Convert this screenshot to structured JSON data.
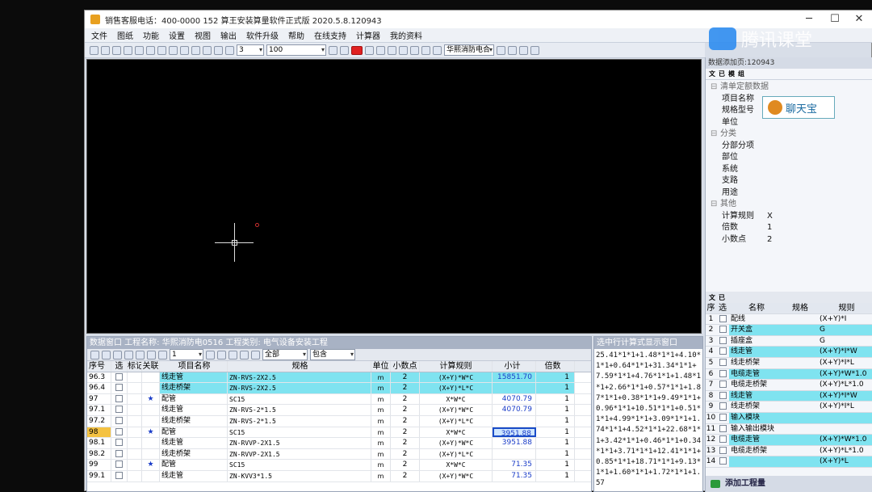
{
  "window": {
    "title": "销售客服电话：400-0000 152  算王安装算量软件正式版 2020.5.8.120943"
  },
  "menu": [
    "文件",
    "图纸",
    "功能",
    "设置",
    "视图",
    "输出",
    "软件升级",
    "帮助",
    "在线支持",
    "计算器",
    "我的资料"
  ],
  "toolbar": {
    "scale_value": "3",
    "zoom_value": "100",
    "project_combo": "华熙消防电合"
  },
  "watermark": "腾讯课堂",
  "right_panel": {
    "title": "数据添加页:120943",
    "tools": [
      "文",
      "已",
      "模",
      "组"
    ],
    "chat_button": "聊天宝",
    "tree": [
      {
        "type": "cat",
        "label": "清单定额数据"
      },
      {
        "type": "leaf",
        "label": "项目名称",
        "value": ""
      },
      {
        "type": "leaf",
        "label": "规格型号",
        "value": ""
      },
      {
        "type": "leaf",
        "label": "单位",
        "value": ""
      },
      {
        "type": "cat",
        "label": "分类"
      },
      {
        "type": "leaf",
        "label": "分部分项",
        "value": ""
      },
      {
        "type": "leaf",
        "label": "部位",
        "value": ""
      },
      {
        "type": "leaf",
        "label": "系统",
        "value": ""
      },
      {
        "type": "leaf",
        "label": "支路",
        "value": ""
      },
      {
        "type": "leaf",
        "label": "用途",
        "value": ""
      },
      {
        "type": "cat",
        "label": "其他"
      },
      {
        "type": "leaf",
        "label": "计算规则",
        "value": "X"
      },
      {
        "type": "leaf",
        "label": "倍数",
        "value": "1"
      },
      {
        "type": "leaf",
        "label": "小数点",
        "value": "2"
      }
    ],
    "grid_headers": {
      "no": "序",
      "sel": "选",
      "name": "名称",
      "spec": "规格",
      "rule": "规则"
    },
    "grid_rows": [
      {
        "no": "1",
        "name": "配线",
        "spec": "",
        "rule": "(X+Y)*I",
        "cyan": false
      },
      {
        "no": "2",
        "name": "开关盒",
        "spec": "",
        "rule": "G",
        "cyan": true
      },
      {
        "no": "3",
        "name": "插座盒",
        "spec": "",
        "rule": "G",
        "cyan": false
      },
      {
        "no": "4",
        "name": "线走管",
        "spec": "",
        "rule": "(X+Y)*I*W",
        "cyan": true
      },
      {
        "no": "5",
        "name": "线走桥架",
        "spec": "",
        "rule": "(X+Y)*I*L",
        "cyan": false
      },
      {
        "no": "6",
        "name": "电缆走管",
        "spec": "",
        "rule": "(X+Y)*W*1.0",
        "cyan": true
      },
      {
        "no": "7",
        "name": "电缆走桥架",
        "spec": "",
        "rule": "(X+Y)*L*1.0",
        "cyan": false
      },
      {
        "no": "8",
        "name": "线走管",
        "spec": "",
        "rule": "(X+Y)*I*W",
        "cyan": true
      },
      {
        "no": "9",
        "name": "线走桥架",
        "spec": "",
        "rule": "(X+Y)*I*L",
        "cyan": false
      },
      {
        "no": "10",
        "name": "输入模块",
        "spec": "",
        "rule": "",
        "cyan": true
      },
      {
        "no": "11",
        "name": "输入输出模块",
        "spec": "",
        "rule": "",
        "cyan": false
      },
      {
        "no": "12",
        "name": "电缆走管",
        "spec": "",
        "rule": "(X+Y)*W*1.0",
        "cyan": true
      },
      {
        "no": "13",
        "name": "电缆走桥架",
        "spec": "",
        "rule": "(X+Y)*L*1.0",
        "cyan": false
      },
      {
        "no": "14",
        "name": "",
        "spec": "",
        "rule": "(X+Y)*L",
        "cyan": true
      }
    ],
    "add_button": "添加工程量"
  },
  "data_panel": {
    "title": "数据窗口 工程名称: 华熙消防电0516 工程类别: 电气设备安装工程",
    "filter1": "1",
    "filter2": "全部",
    "filter3": "包含",
    "headers": {
      "no": "序号",
      "sel": "选",
      "mark": "标记",
      "rel": "关联",
      "name": "项目名称",
      "spec": "规格",
      "unit": "单位",
      "dp": "小数点",
      "rule": "计算规则",
      "subtotal": "小计",
      "mult": "倍数"
    },
    "rows": [
      {
        "no": "96.3",
        "rel": "",
        "name": "线走管",
        "spec": "ZN-RVS-2X2.5",
        "unit": "m",
        "dp": "2",
        "rule": "(X+Y)*W*C",
        "subtotal": "15851.70",
        "mult": "1",
        "cyan": true
      },
      {
        "no": "96.4",
        "rel": "",
        "name": "线走桥架",
        "spec": "ZN-RVS-2X2.5",
        "unit": "m",
        "dp": "2",
        "rule": "(X+Y)*L*C",
        "subtotal": "",
        "mult": "1",
        "cyan": true
      },
      {
        "no": "97",
        "rel": "★",
        "name": "配管",
        "spec": "SC15",
        "unit": "m",
        "dp": "2",
        "rule": "X*W*C",
        "subtotal": "4070.79",
        "mult": "1"
      },
      {
        "no": "97.1",
        "rel": "",
        "name": "线走管",
        "spec": "ZN-RVS-2*1.5",
        "unit": "m",
        "dp": "2",
        "rule": "(X+Y)*W*C",
        "subtotal": "4070.79",
        "mult": "1"
      },
      {
        "no": "97.2",
        "rel": "",
        "name": "线走桥架",
        "spec": "ZN-RVS-2*1.5",
        "unit": "m",
        "dp": "2",
        "rule": "(X+Y)*L*C",
        "subtotal": "",
        "mult": "1"
      },
      {
        "no": "98",
        "rel": "★",
        "name": "配管",
        "spec": "SC15",
        "unit": "m",
        "dp": "2",
        "rule": "X*W*C",
        "subtotal": "3951.88",
        "mult": "1",
        "sel": true
      },
      {
        "no": "98.1",
        "rel": "",
        "name": "线走管",
        "spec": "ZN-RVVP-2X1.5",
        "unit": "m",
        "dp": "2",
        "rule": "(X+Y)*W*C",
        "subtotal": "3951.88",
        "mult": "1"
      },
      {
        "no": "98.2",
        "rel": "",
        "name": "线走桥架",
        "spec": "ZN-RVVP-2X1.5",
        "unit": "m",
        "dp": "2",
        "rule": "(X+Y)*L*C",
        "subtotal": "",
        "mult": "1"
      },
      {
        "no": "99",
        "rel": "★",
        "name": "配管",
        "spec": "SC15",
        "unit": "m",
        "dp": "2",
        "rule": "X*W*C",
        "subtotal": "71.35",
        "mult": "1"
      },
      {
        "no": "99.1",
        "rel": "",
        "name": "线走管",
        "spec": "ZN-KVV3*1.5",
        "unit": "m",
        "dp": "2",
        "rule": "(X+Y)*W*C",
        "subtotal": "71.35",
        "mult": "1"
      }
    ]
  },
  "formula_panel": {
    "title": "选中行计算式显示窗口",
    "text": "25.41*1*1+1.48*1*1+4.10*1*1+0.64*1*1+31.34*1*1+7.59*1*1+4.76*1*1+1.48*1*1+2.66*1*1+0.57*1*1+1.87*1*1+0.38*1*1+9.49*1*1+0.96*1*1+10.51*1*1+0.51*1*1+4.99*1*1+3.09*1*1+1.74*1*1+4.52*1*1+22.68*1*1+3.42*1*1+0.46*1*1+0.34*1*1+3.71*1*1+12.41*1*1+0.85*1*1+18.71*1*1+9.13*1*1+1.60*1*1+1.72*1*1+1.57"
  }
}
